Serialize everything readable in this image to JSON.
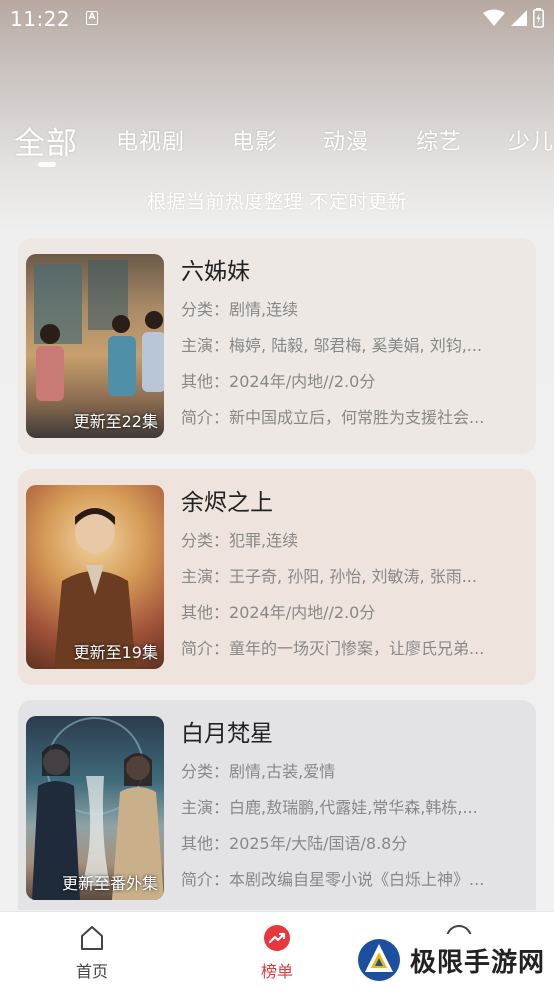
{
  "status_bar": {
    "time": "11:22",
    "notification_icon": "A"
  },
  "tabs": [
    "全部",
    "电视剧",
    "电影",
    "动漫",
    "综艺",
    "少儿"
  ],
  "subtitle": "根据当前热度整理 不定时更新",
  "items": [
    {
      "title": "六姊妹",
      "badge": "更新至22集",
      "rows": [
        {
          "label": "分类：",
          "value": "剧情,连续"
        },
        {
          "label": "主演：",
          "value": "梅婷, 陆毅, 邬君梅, 奚美娟, 刘钧,..."
        },
        {
          "label": "其他：",
          "value": "2024年/内地//2.0分"
        },
        {
          "label": "简介：",
          "value": "新中国成立后，何常胜为支援社会..."
        }
      ]
    },
    {
      "title": "余烬之上",
      "badge": "更新至19集",
      "rows": [
        {
          "label": "分类：",
          "value": "犯罪,连续"
        },
        {
          "label": "主演：",
          "value": "王子奇, 孙阳, 孙怡, 刘敏涛, 张雨..."
        },
        {
          "label": "其他：",
          "value": "2024年/内地//2.0分"
        },
        {
          "label": "简介：",
          "value": "童年的一场灭门惨案，让廖氏兄弟..."
        }
      ]
    },
    {
      "title": "白月梵星",
      "badge": "更新至番外集",
      "rows": [
        {
          "label": "分类：",
          "value": "剧情,古装,爱情"
        },
        {
          "label": "主演：",
          "value": "白鹿,敖瑞鹏,代露娃,常华森,韩栋,..."
        },
        {
          "label": "其他：",
          "value": "2025年/大陆/国语/8.8分"
        },
        {
          "label": "简介：",
          "value": "本剧改编自星零小说《白烁上神》..."
        }
      ]
    }
  ],
  "bottom_nav": [
    {
      "label": "首页",
      "icon": "home-icon"
    },
    {
      "label": "榜单",
      "icon": "ranking-icon"
    }
  ],
  "watermark": {
    "text": "极限手游网"
  },
  "colors": {
    "accent": "#e8383d"
  }
}
